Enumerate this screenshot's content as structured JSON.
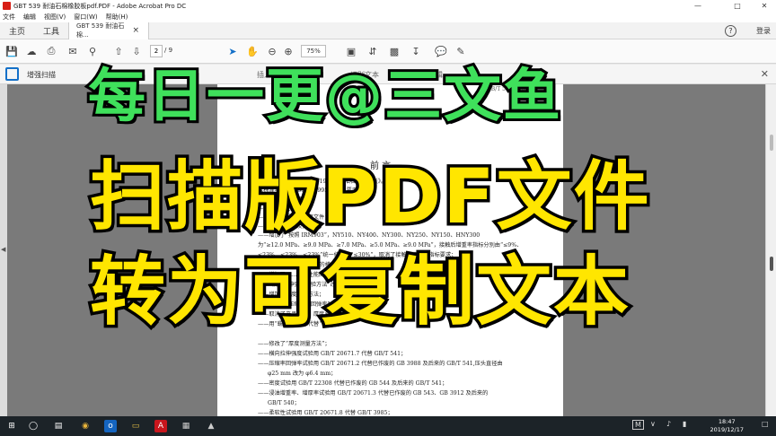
{
  "window": {
    "title": "GBT 539 耐油石棉橡胶板pdf.PDF - Adobe Acrobat Pro DC",
    "minimize": "—",
    "maximize": "□",
    "close": "✕"
  },
  "menu": [
    "文件",
    "编辑",
    "视图(V)",
    "窗口(W)",
    "帮助(H)"
  ],
  "tabs": {
    "home": "主页",
    "tools": "工具",
    "document": "GBT 539 耐油石棉...",
    "document_close": "×",
    "help": "?",
    "login": "登录"
  },
  "toolbar": {
    "page_current": "2",
    "page_total": "/ 9",
    "zoom": "75%"
  },
  "subtoolbar": {
    "label": "增强扫描",
    "insert": "插入",
    "recognize": "识别文本",
    "edit": "Beta 编辑"
  },
  "document": {
    "header": "GB/T 539—2008",
    "preface_title": "前  言",
    "lines": [
      "本标准代替 GB/T 539—1995《耐油石棉橡胶板》。",
      "本标准与 GB/T 539—1995 相比主要变化如下：",
      "——修改了标准名称；",
      "——修改了范围；",
      "——增加了规范性引用文件；",
      "——修改了牌号及其标记；",
      "——增加了“按照 IRM903”，NY510、NY400、NY300、NY250、NY150、HNY300",
      "为“≥12.0 MPa、≥9.0 MPa、≥7.0 MPa、≥5.0 MPa、≥9.0 MPa”，接触后增重率指标分别由“≤9%、",
      "≤23%、≤23%、≤23%”统一修改为“≤30%”，取消了接触后增厚率指标要求；",
      "——取消了牌号 NY250 的横向拉伸强度、 NY250、",
      "——增加了……物理性能的要求；",
      "——“横向拉伸强度试验方法”改为“……”；",
      "——增加了厚度测量方法；",
      "——修改了“压缩率、回弹率”的规定；",
      "——取消了产品厚度、厚度允许偏差的规定；",
      "——用“蠕变松弛率”代替“……”；",
      "——修改了“厚度测量方法”；",
      "——横向拉伸强度试验用 GB/T 20671.7 代替 GB/T 541；",
      "——压缩率回弹率试验用 GB/T 20671.2 代替已作废的 GB 3988 及后来的 GB/T 541,压头直径由",
      "φ25 mm 改为 φ6.4 mm；",
      "——密度试验用 GB/T 22308 代替已作废的 GB 544 及后来的 GB/T 541；",
      "——浸油增重率、增厚率试验用 GB/T 20671.3 代替已作废的 GB 543、GB 3912 及后来的",
      "GB/T 540；",
      "——柔软性试验用 GB/T 20671.8 代替 GB/T 3985；"
    ]
  },
  "overlay": {
    "line1": "每日一更@三文鱼",
    "line2": "扫描版PDF文件",
    "line3": "转为可复制文本"
  },
  "taskbar": {
    "time": "18:47",
    "date": "2019/12/17",
    "ime": "M"
  },
  "colors": {
    "overlay_green": "#3fe05b",
    "overlay_yellow": "#ffe600",
    "acrobat_red": "#d71e16",
    "accent_blue": "#1470c8"
  }
}
